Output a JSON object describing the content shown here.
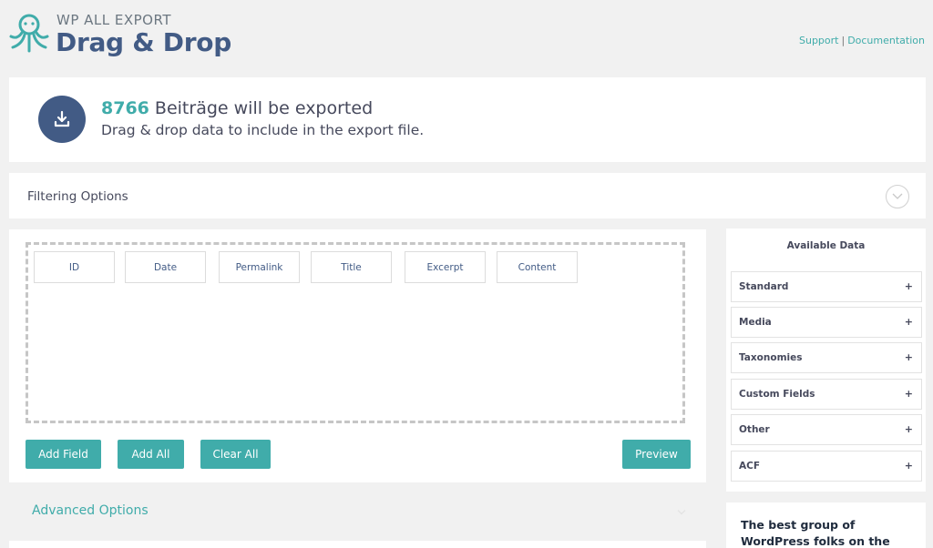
{
  "header": {
    "brand_small": "WP ALL EXPORT",
    "brand_title": "Drag & Drop",
    "support_link": "Support",
    "separator": "|",
    "documentation_link": "Documentation"
  },
  "export_summary": {
    "count": "8766",
    "line1_rest": " Beiträge will be exported",
    "line2": "Drag & drop data to include in the export file."
  },
  "filtering": {
    "title": "Filtering Options"
  },
  "fields": [
    {
      "label": "ID"
    },
    {
      "label": "Date"
    },
    {
      "label": "Permalink"
    },
    {
      "label": "Title"
    },
    {
      "label": "Excerpt"
    },
    {
      "label": "Content"
    }
  ],
  "buttons": {
    "add_field": "Add Field",
    "add_all": "Add All",
    "clear_all": "Clear All",
    "preview": "Preview"
  },
  "advanced": {
    "title": "Advanced Options"
  },
  "available_data": {
    "title": "Available Data",
    "items": [
      {
        "label": "Standard",
        "toggle": "+"
      },
      {
        "label": "Media",
        "toggle": "+"
      },
      {
        "label": "Taxonomies",
        "toggle": "+"
      },
      {
        "label": "Custom Fields",
        "toggle": "+"
      },
      {
        "label": "Other",
        "toggle": "+"
      },
      {
        "label": "ACF",
        "toggle": "+"
      }
    ]
  },
  "promo": {
    "text": "The best group of WordPress folks on the Internet."
  },
  "colors": {
    "accent": "#40acaa",
    "brand": "#425b85",
    "background": "#f1f1f1"
  },
  "icons": {
    "logo": "octopus-logo-icon",
    "export": "download-tray-icon",
    "filter_toggle": "chevron-down-icon"
  }
}
